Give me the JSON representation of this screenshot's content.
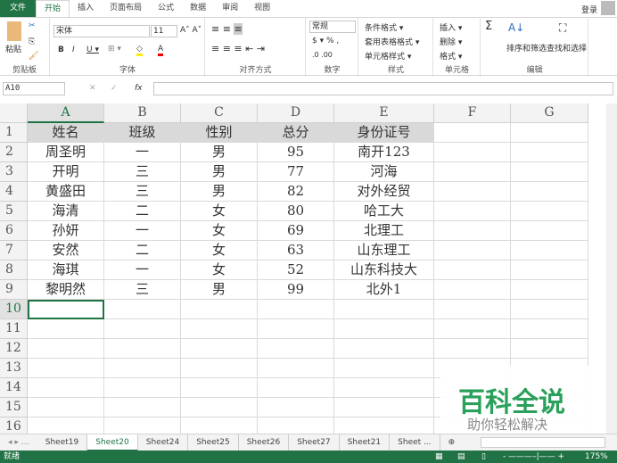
{
  "tabs": [
    "文件",
    "开始",
    "插入",
    "页面布局",
    "公式",
    "数据",
    "审阅",
    "视图"
  ],
  "login": "登录",
  "ribbon": {
    "paste": "粘贴",
    "clipboard": "剪贴板",
    "font_name": "宋体",
    "font_size": "11",
    "font_group": "字体",
    "align_group": "对齐方式",
    "number_format": "常规",
    "number_group": "数字",
    "cond_format": "条件格式 ▾",
    "table_format": "套用表格格式 ▾",
    "cell_style": "单元格样式 ▾",
    "styles_group": "样式",
    "insert": "插入 ▾",
    "delete": "删除 ▾",
    "format": "格式 ▾",
    "cells_group": "单元格",
    "sort_filter": "排序和筛选",
    "find_select": "查找和选择",
    "editing_group": "编辑"
  },
  "formula_bar": {
    "name_box": "A10",
    "fx": "fx",
    "value": ""
  },
  "columns": [
    "A",
    "B",
    "C",
    "D",
    "E",
    "F",
    "G"
  ],
  "rows": [
    [
      "姓名",
      "班级",
      "性别",
      "总分",
      "身份证号"
    ],
    [
      "周圣明",
      "一",
      "男",
      "95",
      "南开123"
    ],
    [
      "开明",
      "三",
      "男",
      "77",
      "河海"
    ],
    [
      "黄盛田",
      "三",
      "男",
      "82",
      "对外经贸"
    ],
    [
      "海清",
      "二",
      "女",
      "80",
      "哈工大"
    ],
    [
      "孙妍",
      "一",
      "女",
      "69",
      "北理工"
    ],
    [
      "安然",
      "二",
      "女",
      "63",
      "山东理工"
    ],
    [
      "海琪",
      "一",
      "女",
      "52",
      "山东科技大"
    ],
    [
      "黎明然",
      "三",
      "男",
      "99",
      "北外1"
    ]
  ],
  "row_numbers": [
    "1",
    "2",
    "3",
    "4",
    "5",
    "6",
    "7",
    "8",
    "9",
    "10",
    "11",
    "12",
    "13",
    "14",
    "15",
    "16"
  ],
  "sheets": [
    "Sheet19",
    "Sheet20",
    "Sheet24",
    "Sheet25",
    "Sheet26",
    "Sheet27",
    "Sheet21",
    "Sheet ..."
  ],
  "active_sheet": "Sheet20",
  "status": {
    "ready": "就绪",
    "zoom": "175%"
  },
  "watermark": {
    "title": "百科全说",
    "subtitle": "助你轻松解决"
  },
  "colors": {
    "accent": "#217346",
    "header_fill": "#d9d9d9"
  }
}
